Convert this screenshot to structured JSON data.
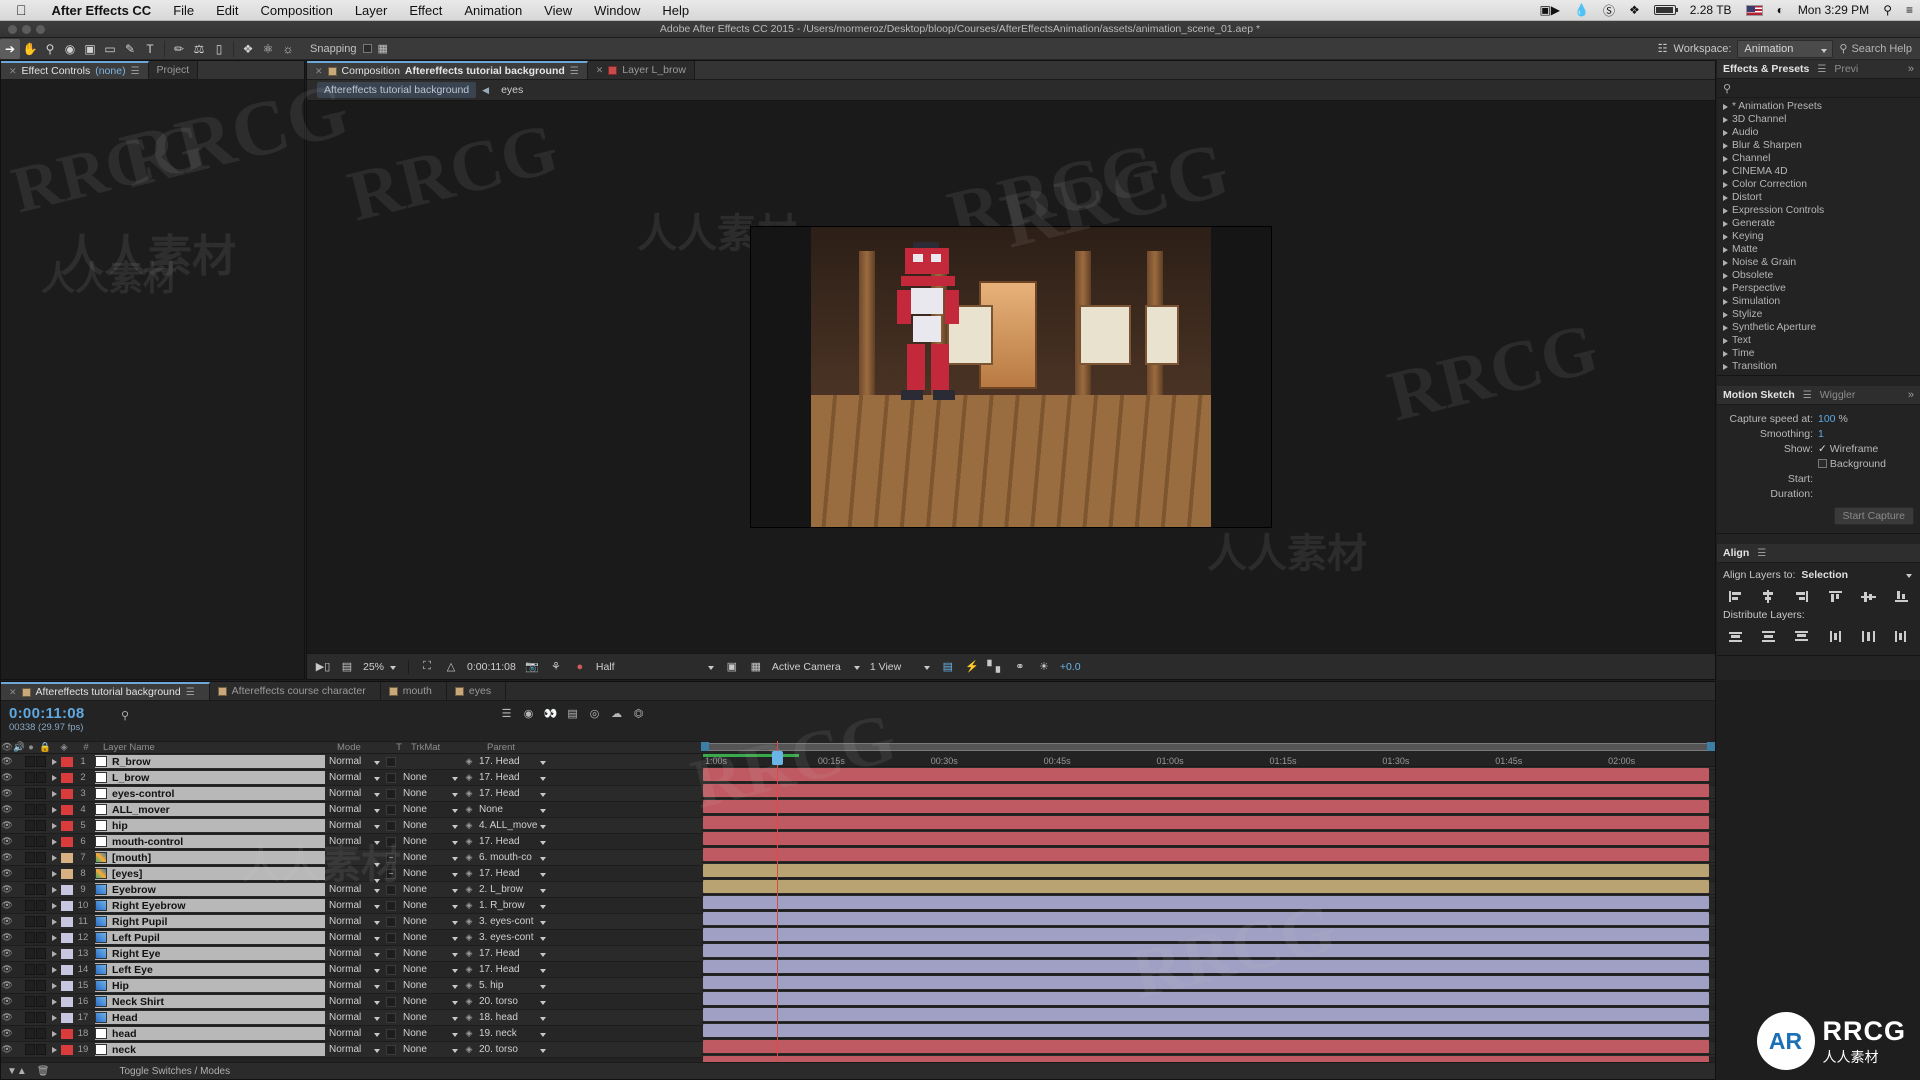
{
  "macmenu": {
    "apple_icon": "apple-icon",
    "items": [
      "After Effects CC",
      "File",
      "Edit",
      "Composition",
      "Layer",
      "Effect",
      "Animation",
      "View",
      "Window",
      "Help"
    ],
    "right": {
      "video_icon": "screen-record-icon",
      "flame_icon": "flame-icon",
      "cc_icon": "creative-cloud-icon",
      "dropbox_icon": "dropbox-icon",
      "storage": "2.28 TB",
      "battery_icon": "battery-icon",
      "flag_icon": "us-flag-icon",
      "wifi_icon": "wifi-icon",
      "clock": "Mon 3:29 PM",
      "search_icon": "spotlight-icon",
      "menu_icon": "control-center-icon"
    }
  },
  "window": {
    "title": "Adobe After Effects CC 2015 - /Users/mormeroz/Desktop/bloop/Courses/AfterEffectsAnimation/assets/animation_scene_01.aep *"
  },
  "toolbar": {
    "tools": [
      "selection-tool",
      "hand-tool",
      "zoom-tool",
      "orbit-camera-tool",
      "pan-behind-tool",
      "rectangle-tool",
      "pen-tool",
      "type-tool",
      "brush-tool",
      "clone-stamp-tool",
      "eraser-tool",
      "roto-brush-tool",
      "puppet-pin-tool"
    ],
    "snapping_label": "Snapping",
    "workspace_label": "Workspace:",
    "workspace_value": "Animation",
    "search_help_placeholder": "Search Help"
  },
  "left_panel": {
    "tabs": [
      {
        "label": "Effect Controls",
        "sub": "(none)",
        "active": true
      },
      {
        "label": "Project",
        "active": false
      }
    ]
  },
  "comp_panel": {
    "tabs": [
      {
        "label": "Composition",
        "sub": "Aftereffects tutorial background",
        "active": true,
        "swatch": "composition-swatch"
      },
      {
        "label": "Layer L_brow",
        "active": false,
        "swatch": "layer-swatch"
      }
    ],
    "breadcrumb": [
      "Aftereffects tutorial background",
      "eyes"
    ],
    "footer": {
      "zoom": "25%",
      "timecode": "0:00:11:08",
      "resolution": "Half",
      "camera": "Active Camera",
      "views": "1 View",
      "exposure": "+0.0"
    }
  },
  "effects_presets": {
    "title": "Effects & Presets",
    "alt_tab": "Previ",
    "search_icon": "search-icon",
    "categories": [
      "* Animation Presets",
      "3D Channel",
      "Audio",
      "Blur & Sharpen",
      "Channel",
      "CINEMA 4D",
      "Color Correction",
      "Distort",
      "Expression Controls",
      "Generate",
      "Keying",
      "Matte",
      "Noise & Grain",
      "Obsolete",
      "Perspective",
      "Simulation",
      "Stylize",
      "Synthetic Aperture",
      "Text",
      "Time",
      "Transition"
    ]
  },
  "motion_sketch": {
    "title": "Motion Sketch",
    "alt_tab": "Wiggler",
    "capture_speed_label": "Capture speed at:",
    "capture_speed_value": "100",
    "capture_speed_unit": "%",
    "smoothing_label": "Smoothing:",
    "smoothing_value": "1",
    "show_label": "Show:",
    "show_wireframe": "Wireframe",
    "show_background": "Background",
    "start_label": "Start:",
    "duration_label": "Duration:",
    "start_capture_button": "Start Capture"
  },
  "align": {
    "title": "Align",
    "align_layers_label": "Align Layers to:",
    "align_layers_value": "Selection",
    "distribute_label": "Distribute Layers:",
    "align_icons": [
      "align-left-icon",
      "align-center-h-icon",
      "align-right-icon",
      "align-top-icon",
      "align-middle-v-icon",
      "align-bottom-icon"
    ],
    "distribute_icons": [
      "distribute-top-icon",
      "distribute-middle-v-icon",
      "distribute-bottom-icon",
      "distribute-left-icon",
      "distribute-center-h-icon",
      "distribute-right-icon"
    ]
  },
  "timeline": {
    "tabs": [
      {
        "label": "Aftereffects tutorial background",
        "active": true,
        "swatch": "comp-swatch"
      },
      {
        "label": "Aftereffects course character",
        "active": false,
        "swatch": "comp-swatch"
      },
      {
        "label": "mouth",
        "active": false,
        "swatch": "comp-swatch"
      },
      {
        "label": "eyes",
        "active": false,
        "swatch": "comp-swatch"
      }
    ],
    "current_time": "0:00:11:08",
    "frame_info": "00338 (29.97 fps)",
    "search_icon": "search-icon",
    "columns": [
      "Layer Name",
      "Mode",
      "T",
      "TrkMat",
      "Parent"
    ],
    "col_hash": "#",
    "footer_label": "Toggle Switches / Modes",
    "ruler_ticks": [
      "1:00s",
      "00:15s",
      "00:30s",
      "00:45s",
      "01:00s",
      "01:15s",
      "01:30s",
      "01:45s",
      "02:00s"
    ],
    "layers": [
      {
        "num": "1",
        "name": "R_brow",
        "mode": "Normal",
        "trkmat": "",
        "parent": "17. Head",
        "swatch": "#d93c3c",
        "type": "solid",
        "bar": "#c05a62"
      },
      {
        "num": "2",
        "name": "L_brow",
        "mode": "Normal",
        "trkmat": "None",
        "parent": "17. Head",
        "swatch": "#d93c3c",
        "type": "solid",
        "bar": "#c05a62"
      },
      {
        "num": "3",
        "name": "eyes-control",
        "mode": "Normal",
        "trkmat": "None",
        "parent": "17. Head",
        "swatch": "#d93c3c",
        "type": "solid",
        "bar": "#c05a62"
      },
      {
        "num": "4",
        "name": "ALL_mover",
        "mode": "Normal",
        "trkmat": "None",
        "parent": "None",
        "swatch": "#d93c3c",
        "type": "solid",
        "bar": "#c05a62"
      },
      {
        "num": "5",
        "name": "hip",
        "mode": "Normal",
        "trkmat": "None",
        "parent": "4. ALL_move",
        "swatch": "#d93c3c",
        "type": "solid",
        "bar": "#c05a62"
      },
      {
        "num": "6",
        "name": "mouth-control",
        "mode": "Normal",
        "trkmat": "None",
        "parent": "17. Head",
        "swatch": "#d93c3c",
        "type": "solid",
        "bar": "#c05a62"
      },
      {
        "num": "7",
        "name": "[mouth]",
        "mode": "",
        "trkmat": "None",
        "parent": "6. mouth-co",
        "swatch": "#d8b183",
        "type": "comp",
        "bar": "#b9a373"
      },
      {
        "num": "8",
        "name": "[eyes]",
        "mode": "",
        "trkmat": "None",
        "parent": "17. Head",
        "swatch": "#d8b183",
        "type": "comp",
        "bar": "#b9a373"
      },
      {
        "num": "9",
        "name": "Eyebrow",
        "mode": "Normal",
        "trkmat": "None",
        "parent": "2. L_brow",
        "swatch": "#c6c6e0",
        "type": "footage",
        "bar": "#a0a0c4"
      },
      {
        "num": "10",
        "name": "Right Eyebrow",
        "mode": "Normal",
        "trkmat": "None",
        "parent": "1. R_brow",
        "swatch": "#c6c6e0",
        "type": "footage",
        "bar": "#a0a0c4"
      },
      {
        "num": "11",
        "name": "Right Pupil",
        "mode": "Normal",
        "trkmat": "None",
        "parent": "3. eyes-cont",
        "swatch": "#c6c6e0",
        "type": "footage",
        "bar": "#a0a0c4"
      },
      {
        "num": "12",
        "name": "Left Pupil",
        "mode": "Normal",
        "trkmat": "None",
        "parent": "3. eyes-cont",
        "swatch": "#c6c6e0",
        "type": "footage",
        "bar": "#a0a0c4"
      },
      {
        "num": "13",
        "name": "Right Eye",
        "mode": "Normal",
        "trkmat": "None",
        "parent": "17. Head",
        "swatch": "#c6c6e0",
        "type": "footage",
        "bar": "#a0a0c4"
      },
      {
        "num": "14",
        "name": "Left Eye",
        "mode": "Normal",
        "trkmat": "None",
        "parent": "17. Head",
        "swatch": "#c6c6e0",
        "type": "footage",
        "bar": "#a0a0c4"
      },
      {
        "num": "15",
        "name": "Hip",
        "mode": "Normal",
        "trkmat": "None",
        "parent": "5. hip",
        "swatch": "#c6c6e0",
        "type": "footage",
        "bar": "#a0a0c4"
      },
      {
        "num": "16",
        "name": "Neck Shirt",
        "mode": "Normal",
        "trkmat": "None",
        "parent": "20. torso",
        "swatch": "#c6c6e0",
        "type": "footage",
        "bar": "#a0a0c4"
      },
      {
        "num": "17",
        "name": "Head",
        "mode": "Normal",
        "trkmat": "None",
        "parent": "18. head",
        "swatch": "#c6c6e0",
        "type": "footage",
        "bar": "#a0a0c4"
      },
      {
        "num": "18",
        "name": "head",
        "mode": "Normal",
        "trkmat": "None",
        "parent": "19. neck",
        "swatch": "#d93c3c",
        "type": "solid",
        "bar": "#c05a62"
      },
      {
        "num": "19",
        "name": "neck",
        "mode": "Normal",
        "trkmat": "None",
        "parent": "20. torso",
        "swatch": "#d93c3c",
        "type": "solid",
        "bar": "#c05a62"
      }
    ]
  },
  "watermarks": {
    "rrcg": "RRCG",
    "cn": "人人素材",
    "logo_text": "RRCG",
    "logo_sub": "人人素材",
    "logo_mark": "AR"
  }
}
